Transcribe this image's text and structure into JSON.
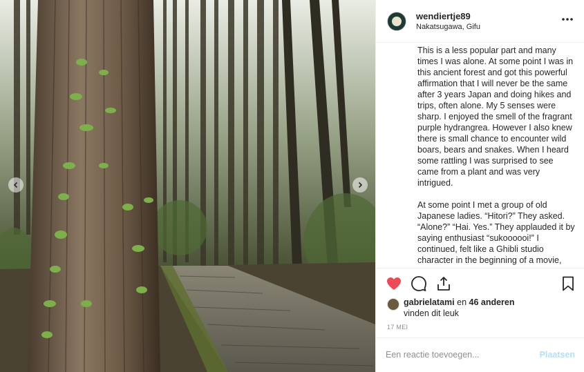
{
  "post": {
    "username": "wendiertje89",
    "location": "Nakatsugawa, Gifu",
    "more_icon": "more-horizontal-icon",
    "caption": {
      "paragraph1": "This is a less popular part and many times I was alone. At some point I was in this ancient forest and got this powerful affirmation that I will never be the same after 3 years Japan and doing hikes and trips, often alone. My 5 senses were sharp. I enjoyed the smell of the fragrant purple hydrangrea. However I also knew there is small chance to encounter wild boars, bears and snakes. When I heard some rattling I was surprised to see came from a plant and was very intrigued.",
      "paragraph2": "At some point I met a group of old Japanese ladies. “Hitori?” They asked. “Alone?” “Hai. Yes.” They applauded it by saying enthusiast “sukoooooi!” I continued, felt like a Ghibli studio character in the beginning of a movie,"
    },
    "likes": {
      "liker": "gabrielatami",
      "connector": " en ",
      "others": "46 anderen",
      "suffix": "vinden dit leuk"
    },
    "date": "17 MEI",
    "comment": {
      "placeholder": "Een reactie toevoegen...",
      "post_label": "Plaatsen"
    },
    "colors": {
      "heart": "#ed4956",
      "post_button": "#b2dffc",
      "secondary_text": "#8e8e8e"
    },
    "icons": [
      "heart-icon",
      "comment-icon",
      "share-icon",
      "bookmark-icon",
      "chevron-left-icon",
      "chevron-right-icon"
    ]
  }
}
